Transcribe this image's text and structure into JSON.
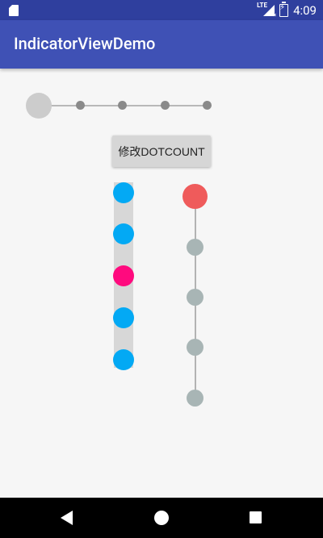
{
  "status_bar": {
    "network": "LTE",
    "time": "4:09",
    "icons": [
      "sd-card-icon",
      "lte-signal-icon",
      "battery-charging-icon"
    ]
  },
  "app_bar": {
    "title": "IndicatorViewDemo"
  },
  "horizontal_indicator": {
    "dot_count": 5,
    "selected_index": 0,
    "selected_color": "#cccccc",
    "unselected_color": "#8a8a8a",
    "line_color": "#b8b8b8"
  },
  "button": {
    "label": "修改DOTCOUNT"
  },
  "vertical_bar_indicator": {
    "dot_count": 5,
    "selected_index": 2,
    "track_color": "#d7d7d7",
    "selected_color": "#ff0a7e",
    "unselected_color": "#03a9f4"
  },
  "vertical_line_indicator": {
    "dot_count": 5,
    "selected_index": 0,
    "selected_color": "#ef5b5b",
    "unselected_color": "#a8b5b5",
    "line_color": "#b3b3b3"
  },
  "nav_bar": {
    "buttons": [
      "back-icon",
      "home-icon",
      "recents-icon"
    ]
  }
}
